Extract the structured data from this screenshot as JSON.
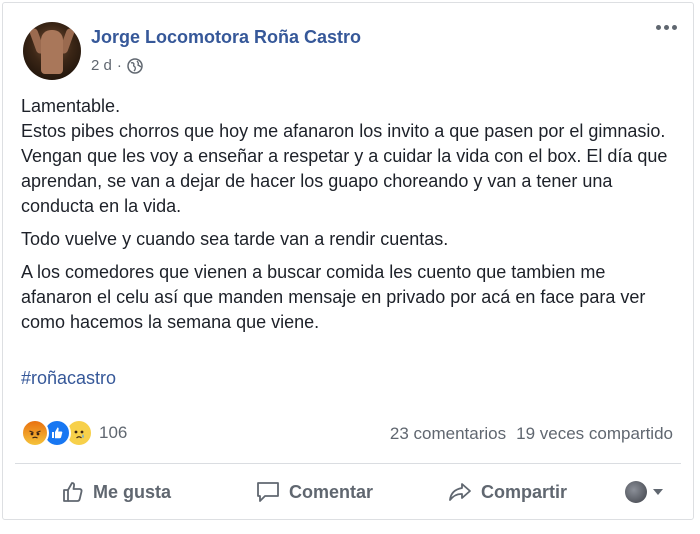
{
  "post": {
    "author": "Jorge Locomotora Roña Castro",
    "time": "2 d",
    "privacy_icon": "globe-icon",
    "paragraphs": [
      "Lamentable.",
      "Estos pibes chorros que hoy me afanaron los invito a que pasen por el gimnasio. Vengan que les voy a enseñar a respetar y a cuidar la vida con el box. El día que aprendan, se van a dejar de hacer los guapo choreando y van a tener una conducta en la vida.",
      "Todo vuelve y cuando sea tarde van a rendir cuentas.",
      "A los comedores que vienen a buscar comida les cuento que tambien me afanaron el celu así que manden mensaje en privado por acá en face para ver como hacemos la semana que viene."
    ],
    "hashtag": "#roñacastro"
  },
  "reactions": {
    "types": [
      "angry",
      "like",
      "sad"
    ],
    "count": "106"
  },
  "stats": {
    "comments": "23 comentarios",
    "shares": "19 veces compartido"
  },
  "actions": {
    "like": "Me gusta",
    "comment": "Comentar",
    "share": "Compartir"
  },
  "colors": {
    "link": "#365899",
    "text": "#1d2129",
    "muted": "#606770",
    "like_blue": "#1877f2"
  }
}
